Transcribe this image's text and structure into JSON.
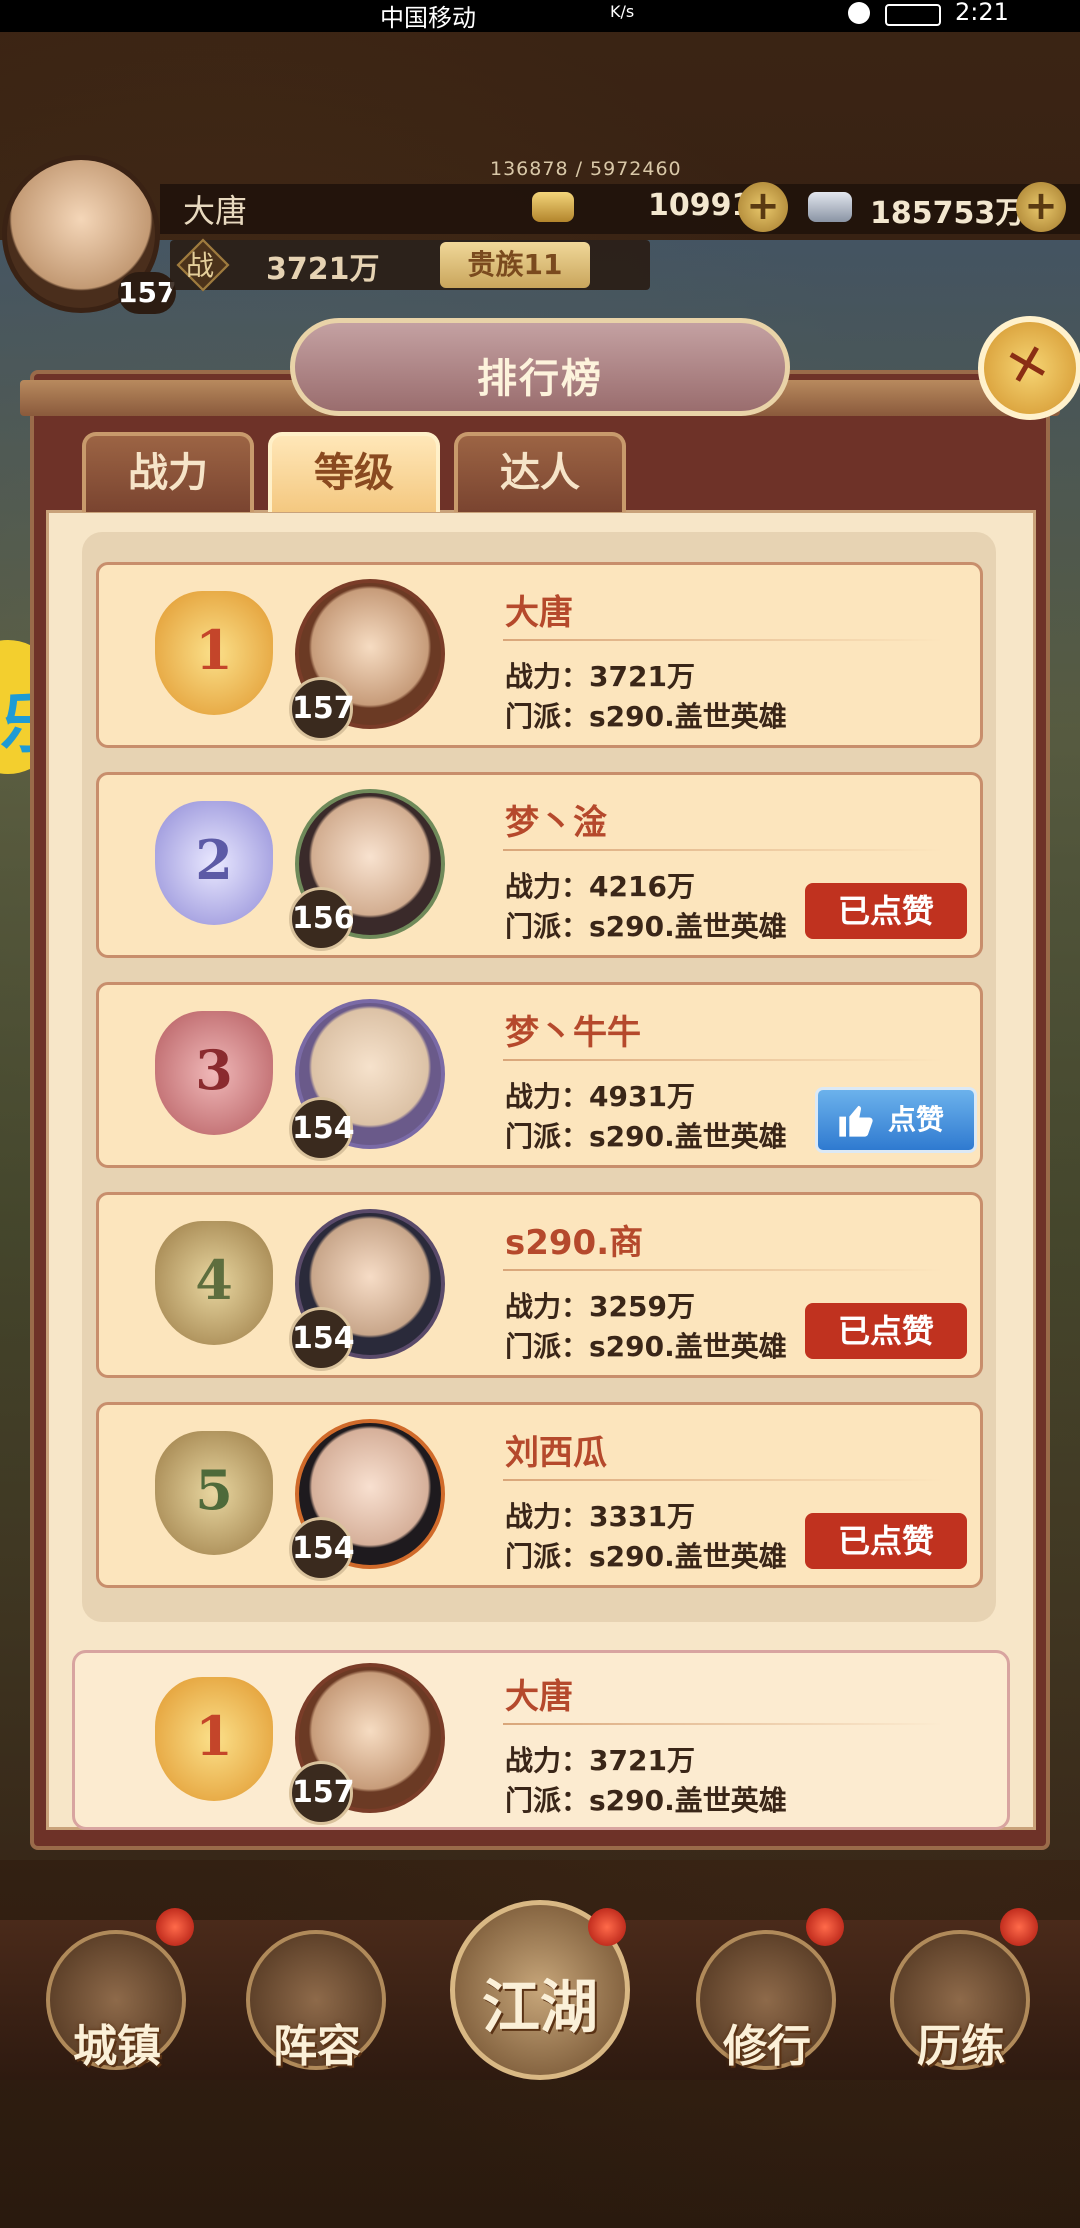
{
  "status_bar": {
    "carrier": "中国移动",
    "net_speed": "K/s",
    "time": "2:21"
  },
  "player": {
    "name": "大唐",
    "level": "157",
    "exp": "136878 / 5972460",
    "gold": "10991",
    "silver": "185753万",
    "power_label": "战",
    "power": "3721万",
    "noble": "贵族11"
  },
  "side_badge": "乐",
  "leaderboard": {
    "title": "排行榜",
    "tabs": [
      {
        "label": "战力",
        "active": false
      },
      {
        "label": "等级",
        "active": true
      },
      {
        "label": "达人",
        "active": false
      }
    ],
    "power_prefix": "战力：",
    "faction_prefix": "门派：",
    "entries": [
      {
        "rank": "1",
        "name": "大唐",
        "level": "157",
        "power": "3721万",
        "faction": "s290.盖世英雄",
        "like_state": "none",
        "like_label": ""
      },
      {
        "rank": "2",
        "name": "梦丶淦",
        "level": "156",
        "power": "4216万",
        "faction": "s290.盖世英雄",
        "like_state": "liked",
        "like_label": "已点赞"
      },
      {
        "rank": "3",
        "name": "梦丶牛牛",
        "level": "154",
        "power": "4931万",
        "faction": "s290.盖世英雄",
        "like_state": "can_like",
        "like_label": "点赞"
      },
      {
        "rank": "4",
        "name": "s290.商",
        "level": "154",
        "power": "3259万",
        "faction": "s290.盖世英雄",
        "like_state": "liked",
        "like_label": "已点赞"
      },
      {
        "rank": "5",
        "name": "刘西瓜",
        "level": "154",
        "power": "3331万",
        "faction": "s290.盖世英雄",
        "like_state": "liked",
        "like_label": "已点赞"
      }
    ],
    "self": {
      "rank": "1",
      "name": "大唐",
      "level": "157",
      "power": "3721万",
      "faction": "s290.盖世英雄"
    }
  },
  "bottom_nav": [
    {
      "label": "城镇",
      "has_dot": true
    },
    {
      "label": "阵容",
      "has_dot": false
    },
    {
      "label": "江湖",
      "has_dot": true
    },
    {
      "label": "修行",
      "has_dot": true
    },
    {
      "label": "历练",
      "has_dot": true
    }
  ],
  "colors": {
    "liked_button": "#c0321f",
    "like_button": "#2f7ad0",
    "name_text": "#b5492c",
    "gold_medal": "#f0b43a",
    "silver_medal": "#a9a6e6",
    "bronze_medal": "#c2676a",
    "green_medal": "#6e8a4e"
  }
}
